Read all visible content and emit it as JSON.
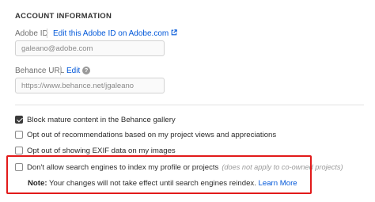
{
  "account": {
    "section_title": "ACCOUNT INFORMATION",
    "adobe_id": {
      "label": "Adobe ID",
      "edit_link": "Edit this Adobe ID on Adobe.com",
      "value": "galeano@adobe.com",
      "link_icon": "external-link-icon"
    },
    "behance_url": {
      "label": "Behance URL",
      "edit_link": "Edit",
      "help_icon": "help-circle-icon",
      "help_glyph": "?",
      "value": "https://www.behance.net/jgaleano"
    }
  },
  "options": [
    {
      "label": "Block mature content in the Behance gallery",
      "checked": true
    },
    {
      "label": "Opt out of recommendations based on my project views and appreciations",
      "checked": false
    },
    {
      "label": "Opt out of showing EXIF data on my images",
      "checked": false
    },
    {
      "label": "Don't allow search engines to index my profile or projects",
      "note": "(does not apply to co-owned projects)",
      "checked": false
    }
  ],
  "note": {
    "prefix": "Note:",
    "text": " Your changes will not take effect until search engines reindex. ",
    "link": "Learn More"
  },
  "colors": {
    "link": "#0057d9",
    "highlight_border": "#e21a1a",
    "checkbox_checked": "#3a3a3a"
  }
}
